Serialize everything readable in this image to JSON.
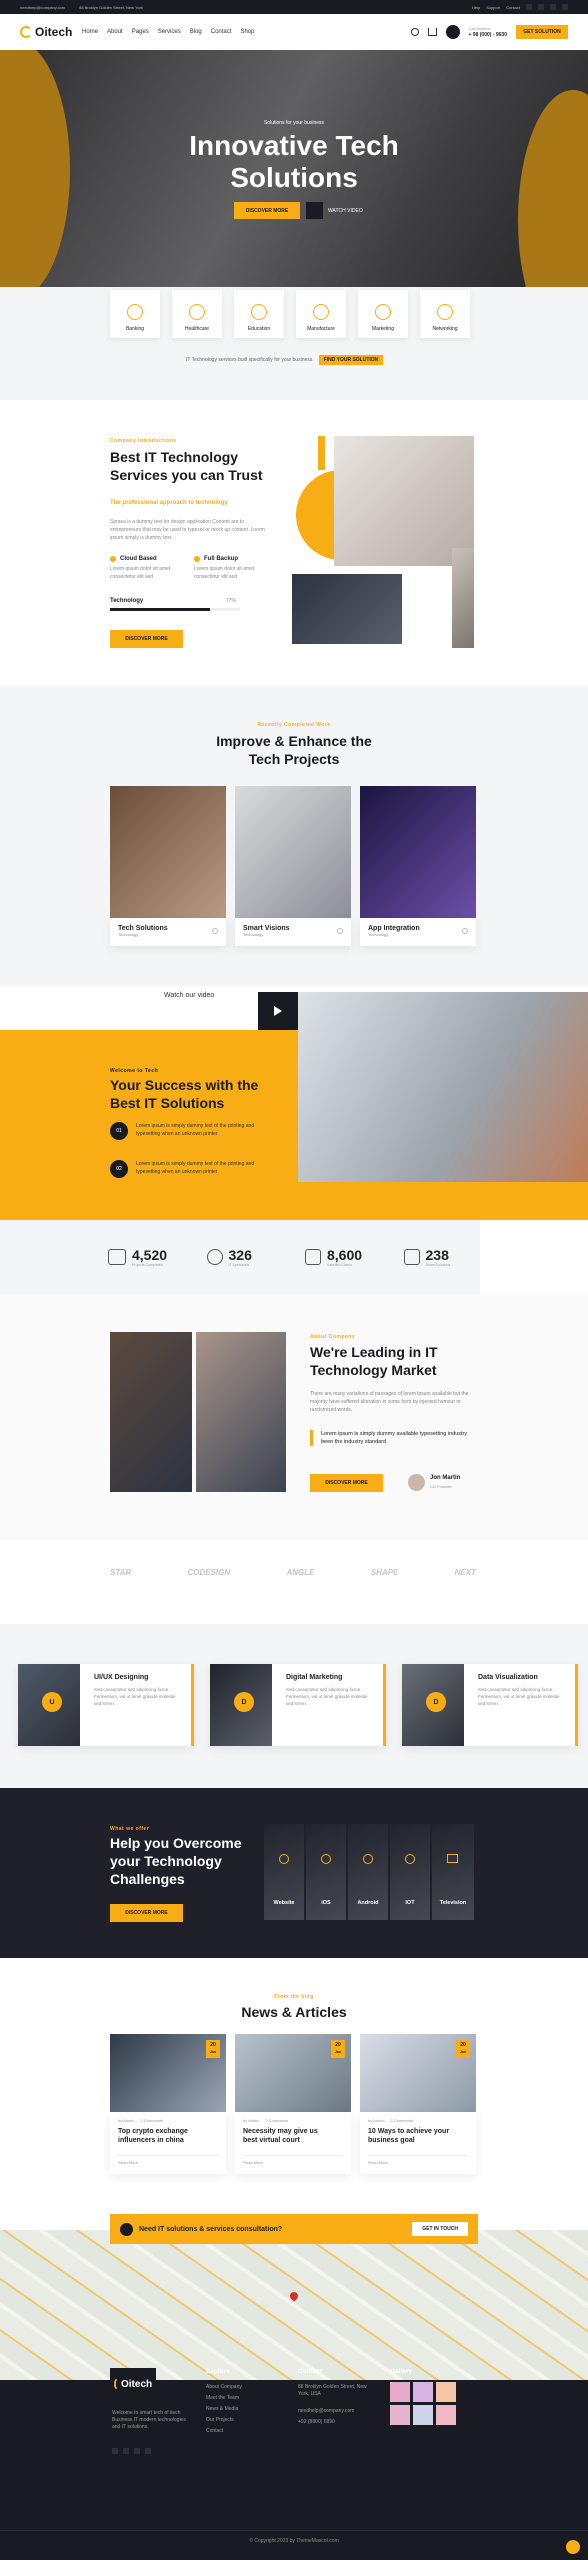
{
  "topbar": {
    "email": "needhelp@company.com",
    "address": "88 Broklyn Golden Street, New York",
    "links": [
      "Help",
      "Support",
      "Contact"
    ]
  },
  "nav": {
    "logo": "Oitech",
    "menu": [
      "Home",
      "About",
      "Pages",
      "Services",
      "Blog",
      "Contact",
      "Shop"
    ],
    "phone_label": "Call Anytime",
    "phone": "+ 98 (000) - 9630",
    "cta": "GET SOLUTION"
  },
  "hero": {
    "kicker": "Solutions for your business",
    "title_line1": "Innovative Tech",
    "title_line2": "Solutions",
    "btn_primary": "DISCOVER MORE",
    "btn_video": "WATCH VIDEO"
  },
  "services": {
    "items": [
      "Banking",
      "Healthcare",
      "Education",
      "Manufacture",
      "Marketing",
      "Networking"
    ],
    "note": "IT Technology services built specifically for your business.",
    "note_btn": "FIND YOUR SOLUTION"
  },
  "about": {
    "kicker": "Company Introductions",
    "title_line1": "Best IT Technology",
    "title_line2": "Services you can Trust",
    "lead": "The professional approach to technology",
    "body": "Sprasa is a dummy text for design application Content are to entrepreneurs that may be used to typeset or mock up content. Lorem ipsum simply is dummy text",
    "feat1": "Cloud Based",
    "feat1_text": "Lorem ipsum dolor sit amet consectetur elit sed",
    "feat2": "Full Backup",
    "feat2_text": "Lorem ipsum dolor sit amet consectetur elit sed",
    "skill_label": "Technology",
    "skill_value": "77%",
    "skill_fraction": 0.77,
    "btn": "DISCOVER MORE"
  },
  "projects": {
    "kicker": "Recently Completed Work",
    "title_line1": "Improve & Enhance the",
    "title_line2": "Tech Projects",
    "items": [
      {
        "title": "Tech Solutions",
        "tag": "Technology"
      },
      {
        "title": "Smart Visions",
        "tag": "Technology"
      },
      {
        "title": "App Integration",
        "tag": "Technology"
      }
    ]
  },
  "video": {
    "label": "Watch our video"
  },
  "success": {
    "kicker": "Welcome to Tech",
    "title_line1": "Your Success with the",
    "title_line2": "Best IT Solutions",
    "points": [
      {
        "num": "01",
        "text": "Lorem ipsum is simply dummy text of the printing and typesetting when an unknown printer"
      },
      {
        "num": "02",
        "text": "Lorem ipsum is simply dummy text of the printing and typesetting when an unknown printer"
      }
    ]
  },
  "stats": [
    {
      "value": "4,520",
      "label": "Projects Completed"
    },
    {
      "value": "326",
      "label": "IT Specialists"
    },
    {
      "value": "8,600",
      "label": "Satisfied Clients"
    },
    {
      "value": "238",
      "label": "Smart Solutions"
    }
  ],
  "leading": {
    "kicker": "About Company",
    "title_line1": "We're Leading in IT",
    "title_line2": "Technology Market",
    "body": "There are many variations of passages of lorem ipsum available but the majority have suffered alteration in some form by injected humour or randomised words.",
    "quote": "Lorem ipsum is simply dummy available typesetting industry been the industry standard",
    "btn": "DISCOVER MORE",
    "author": "Jon Martin",
    "author_role": "CO Founder"
  },
  "brands": [
    "STAR",
    "CODESIGN",
    "ANGLE",
    "SHAPE",
    "NEXT"
  ],
  "features": [
    {
      "letter": "U",
      "title": "UI/UX Designing",
      "text": "Sed consectetur sed adipiscing fusce. Fermentum, vel ut amet gravida molestie sed lorem."
    },
    {
      "letter": "D",
      "title": "Digital Marketing",
      "text": "Sed consectetur sed adipiscing fusce. Fermentum, vel ut amet gravida molestie sed lorem."
    },
    {
      "letter": "D",
      "title": "Data Visualization",
      "text": "Sed consectetur sed adipiscing fusce. Fermentum, vel ut amet gravida molestie sed lorem."
    }
  ],
  "help": {
    "kicker": "What we offer",
    "title_line1": "Help you Overcome",
    "title_line2": "your Technology",
    "title_line3": "Challenges",
    "btn": "DISCOVER MORE",
    "cats": [
      "Website",
      "iOS",
      "Android",
      "IOT",
      "Television"
    ]
  },
  "news": {
    "kicker": "From the blog",
    "title": "News & Articles",
    "items": [
      {
        "day": "20",
        "mon": "Jan",
        "author": "by Admin",
        "comments": "2 Comments",
        "title_line1": "Top crypto exchange",
        "title_line2": "influencers in china",
        "more": "Read More"
      },
      {
        "day": "20",
        "mon": "Jan",
        "author": "by Admin",
        "comments": "2 Comments",
        "title_line1": "Necessity may give us",
        "title_line2": "best virtual court",
        "more": "Read More"
      },
      {
        "day": "20",
        "mon": "Jan",
        "author": "by Admin",
        "comments": "2 Comments",
        "title_line1": "10 Ways to achieve your",
        "title_line2": "business goal",
        "more": "Read More"
      }
    ]
  },
  "cta": {
    "text": "Need IT solutions & services consultation?",
    "btn": "GET IN TOUCH"
  },
  "footer": {
    "logo": "Oitech",
    "about": "Welcome to smart tech of itech Business IT modern technologies and IT solutions.",
    "explore_title": "Explore",
    "explore": [
      "About Company",
      "Meet the Team",
      "News & Media",
      "Our Projects",
      "Contact"
    ],
    "contact_title": "Contact",
    "address": "88 Broklyn Golden Street, New York, USA",
    "email": "needhelp@company.com",
    "phone": "+92 (8800) 6890",
    "gallery_title": "Gallery",
    "copyright": "© Copyright 2023 by ThemeMascot.com"
  }
}
